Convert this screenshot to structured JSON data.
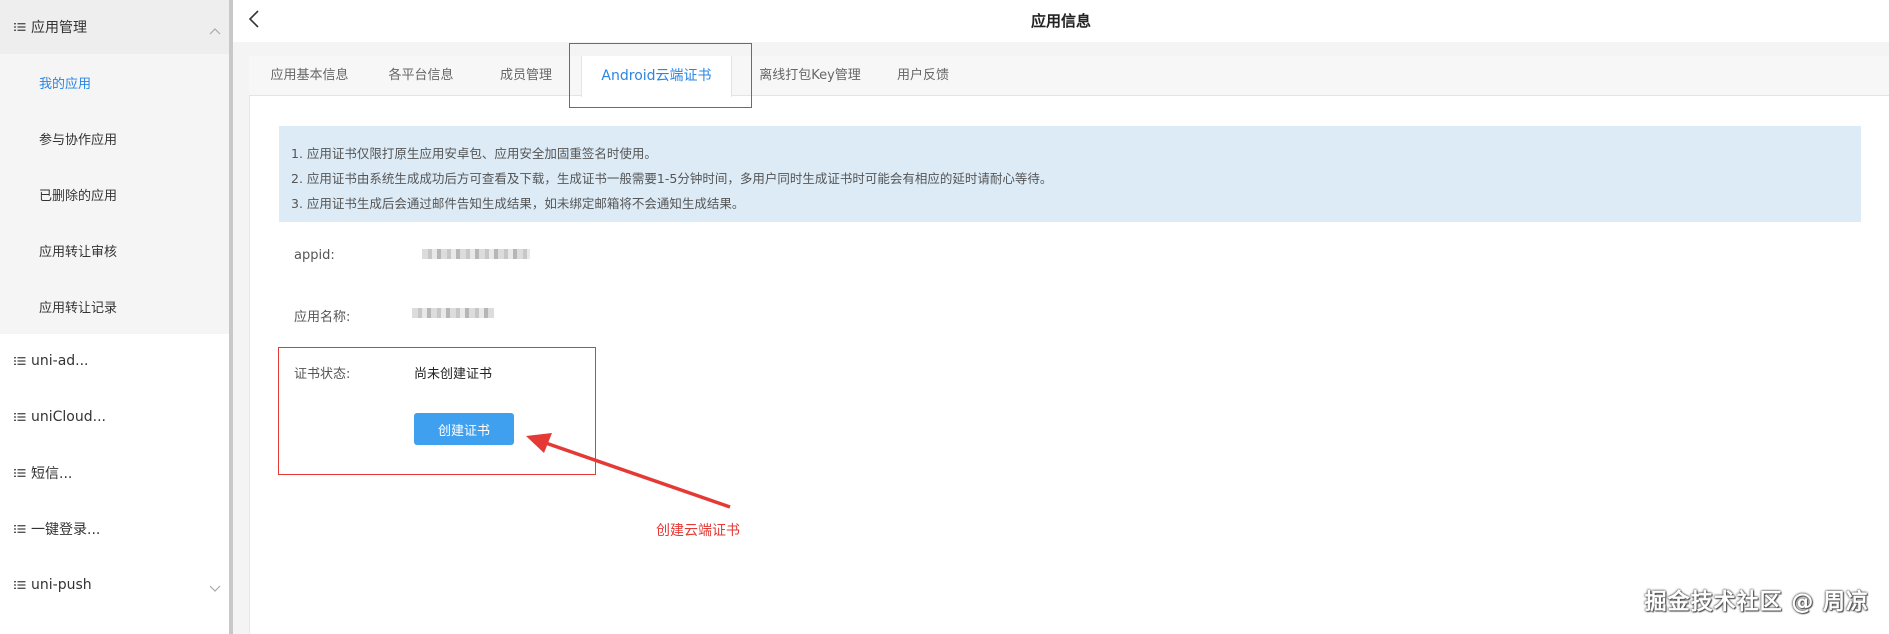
{
  "sidebar": {
    "app_management": "应用管理",
    "submenu": [
      "我的应用",
      "参与协作应用",
      "已删除的应用",
      "应用转让审核",
      "应用转让记录"
    ],
    "groups": [
      "uni-ad...",
      "uniCloud...",
      "短信...",
      "一键登录...",
      "uni-push"
    ]
  },
  "header": {
    "title": "应用信息",
    "back_icon": "chevron-left-icon"
  },
  "tabs": [
    "应用基本信息",
    "各平台信息",
    "成员管理",
    "Android云端证书",
    "离线打包Key管理",
    "用户反馈"
  ],
  "notice": {
    "lines": [
      "1. 应用证书仅限打原生应用安卓包、应用安全加固重签名时使用。",
      "2. 应用证书由系统生成成功后方可查看及下载，生成证书一般需要1-5分钟时间，多用户同时生成证书时可能会有相应的延时请耐心等待。",
      "3. 应用证书生成后会通过邮件告知生成结果，如未绑定邮箱将不会通知生成结果。"
    ]
  },
  "fields": {
    "appid_label": "appid:",
    "app_name_label": "应用名称:",
    "cert_status_label": "证书状态:",
    "cert_status_value": "尚未创建证书"
  },
  "create_button": "创建证书",
  "annotation": "创建云端证书",
  "watermark": "掘金技术社区 @ 周凉",
  "colors": {
    "accent": "#2b85e4",
    "button": "#40a0f0",
    "annotation": "#e53935",
    "notice_bg": "#dcebf6"
  }
}
